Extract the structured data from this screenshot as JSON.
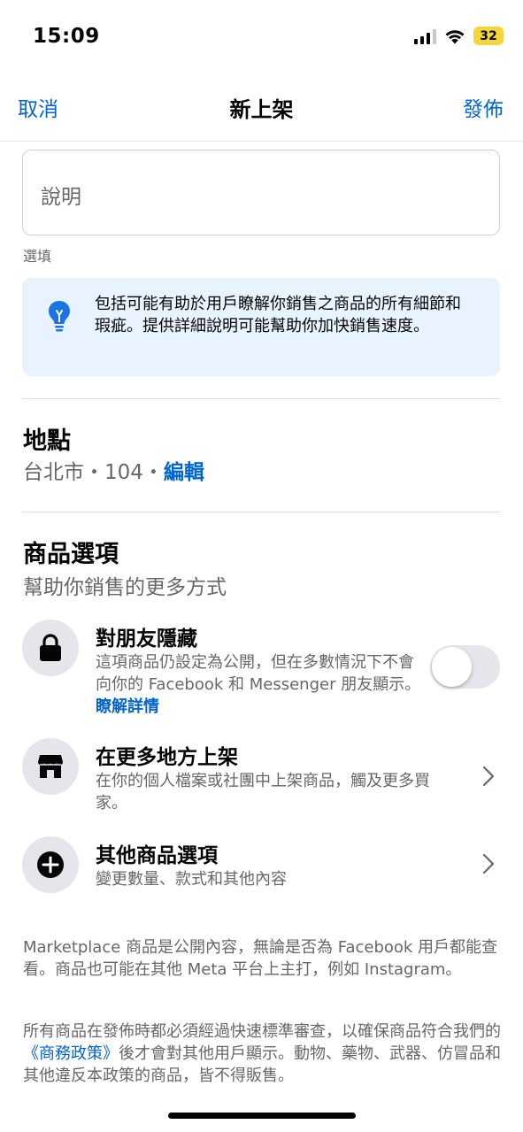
{
  "status_bar": {
    "time": "15:09",
    "battery": "32",
    "icons": [
      "signal-icon",
      "wifi-icon",
      "battery-icon"
    ]
  },
  "nav": {
    "cancel": "取消",
    "title": "新上架",
    "publish": "發佈"
  },
  "description": {
    "placeholder": "說明",
    "hint": "選填"
  },
  "tip": {
    "icon": "lightbulb-icon",
    "text": "包括可能有助於用戶瞭解你銷售之商品的所有細節和瑕疵。提供詳細說明可能幫助你加快銷售速度。"
  },
  "location": {
    "title": "地點",
    "value": "台北市・104・",
    "edit": "編輯"
  },
  "product_options": {
    "title": "商品選項",
    "subtitle": "幫助你銷售的更多方式",
    "items": [
      {
        "icon": "lock-icon",
        "title": "對朋友隱藏",
        "description": "這項商品仍設定為公開，但在多數情況下不會向你的 Facebook 和 Messenger 朋友顯示。",
        "link": "瞭解詳情",
        "toggle_on": false
      },
      {
        "icon": "storefront-icon",
        "title": "在更多地方上架",
        "description": "在你的個人檔案或社團中上架商品，觸及更多買家。"
      },
      {
        "icon": "plus-icon",
        "title": "其他商品選項",
        "description": "變更數量、款式和其他內容"
      }
    ]
  },
  "footer": {
    "paragraph1": "Marketplace 商品是公開內容，無論是否為 Facebook 用戶都能查看。商品也可能在其他 Meta 平台上主打，例如 Instagram。",
    "paragraph2_before": "所有商品在發佈時都必須經過快速標準審查，以確保商品符合我們的",
    "paragraph2_link": "《商務政策》",
    "paragraph2_after": "後才會對其他用戶顯示。動物、藥物、武器、仿冒品和其他違反本政策的商品，皆不得販售。"
  },
  "colors": {
    "accent": "#0064d1",
    "tip_background": "#e7f3ff",
    "secondary_text": "#65676b",
    "battery": "#f3d63a"
  }
}
